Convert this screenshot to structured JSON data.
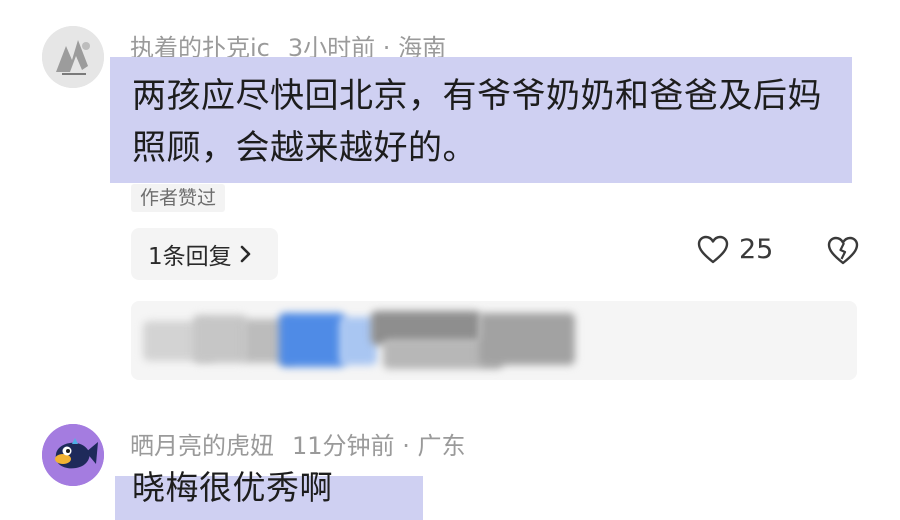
{
  "comments": [
    {
      "username": "执着的扑克ic",
      "time": "3小时前",
      "separator": "·",
      "location": "海南",
      "content": "两孩应尽快回北京，有爷爷奶奶和爸爸及后妈照顾，会越来越好的。",
      "author_liked": "作者赞过",
      "reply_button": "1条回复",
      "like_count": "25",
      "highlight_color": "#cfd0f2"
    },
    {
      "username": "晒月亮的虎妞",
      "time": "11分钟前",
      "separator": "·",
      "location": "广东",
      "content": "晓梅很优秀啊",
      "highlight_color": "#cfd0f2"
    }
  ],
  "icons": {
    "like": "heart-outline-icon",
    "dislike": "broken-heart-icon",
    "reply_arrow": "chevron-right-icon"
  }
}
